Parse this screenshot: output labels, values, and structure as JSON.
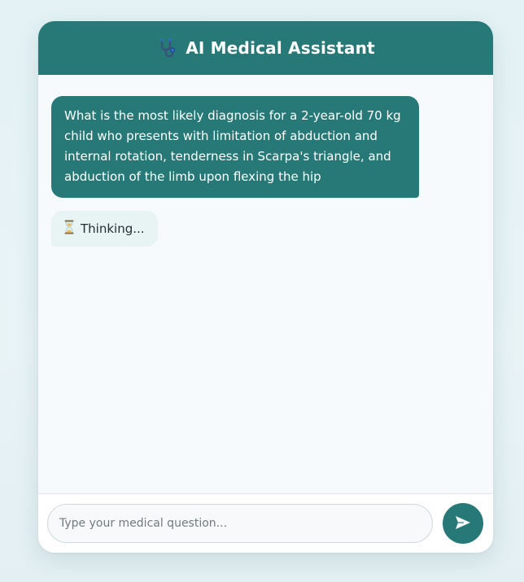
{
  "header": {
    "title": "AI Medical Assistant",
    "icon": "stethoscope-icon"
  },
  "messages": {
    "user": {
      "text": "What is the most likely diagnosis for a 2-year-old 70 kg child who presents with limitation of abduction and internal rotation, tenderness in Scarpa's triangle, and abduction of the limb upon flexing the hip"
    },
    "bot": {
      "icon": "hourglass-icon",
      "text": "Thinking..."
    }
  },
  "input": {
    "placeholder": "Type your medical question...",
    "value": ""
  },
  "send_button": {
    "icon": "send-arrow-icon"
  },
  "colors": {
    "accent": "#267977",
    "bot_bubble": "#e8f3f3",
    "background": "#e4f2f5"
  }
}
